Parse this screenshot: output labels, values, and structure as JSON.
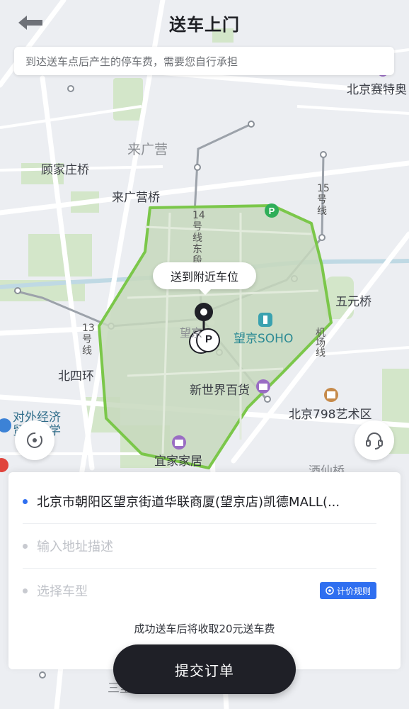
{
  "header": {
    "title": "送车上门"
  },
  "notice": {
    "text": "到达送车点后产生的停车费，需要您自行承担"
  },
  "map": {
    "labels": {
      "beijing_saite": "北京赛特奥",
      "laiguangying_area": "来广营",
      "gujiazhuang_bridge": "顾家庄桥",
      "laiguangying_bridge": "来广营桥",
      "line15": "15号线",
      "line14": "14号线东段",
      "wuyuan_bridge": "五元桥",
      "wangjing_soho": "望京SOHO",
      "airport_expressway": "机场线",
      "line13": "13号线",
      "beisihuan": "北四环",
      "new_world": "新世界百货",
      "art798": "北京798艺术区",
      "uibe": "对外经济贸易大学",
      "ikea": "宜家家居",
      "jiuxianqiao": "酒仙桥",
      "wangjing": "望京",
      "sanlitun": "三里屯"
    },
    "pin_tooltip": "送到附近车位",
    "parking_letter": "P",
    "colors": {
      "zone_border": "#7bc74a",
      "zone_fill": "#c7d8bd",
      "accent": "#2f6ff0"
    }
  },
  "controls": {
    "locate_icon": "locate-icon",
    "service_icon": "headset-icon"
  },
  "form": {
    "address": "北京市朝阳区望京街道华联商厦(望京店)凯德MALL(...",
    "address_detail_placeholder": "输入地址描述",
    "car_type_placeholder": "选择车型",
    "pricing_rule": "计价规则",
    "fee_note": "成功送车后将收取20元送车费"
  },
  "submit": {
    "label": "提交订单"
  }
}
